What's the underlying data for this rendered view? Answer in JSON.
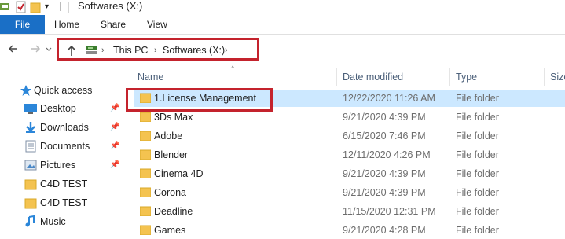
{
  "window": {
    "title": "Softwares (X:)"
  },
  "ribbon": {
    "tabs": [
      "File",
      "Home",
      "Share",
      "View"
    ]
  },
  "address": {
    "crumbs": [
      "This PC",
      "Softwares (X:)"
    ]
  },
  "sidebar": {
    "items": [
      {
        "label": "Quick access",
        "icon": "star-icon",
        "pinned": false
      },
      {
        "label": "Desktop",
        "icon": "desktop-icon",
        "pinned": true
      },
      {
        "label": "Downloads",
        "icon": "downloads-icon",
        "pinned": true
      },
      {
        "label": "Documents",
        "icon": "documents-icon",
        "pinned": true
      },
      {
        "label": "Pictures",
        "icon": "pictures-icon",
        "pinned": true
      },
      {
        "label": "C4D TEST",
        "icon": "folder-icon",
        "pinned": false
      },
      {
        "label": "C4D TEST",
        "icon": "folder-icon",
        "pinned": false
      },
      {
        "label": "Music",
        "icon": "music-icon",
        "pinned": false
      }
    ]
  },
  "columns": {
    "name": "Name",
    "date": "Date modified",
    "type": "Type",
    "size": "Size"
  },
  "files": [
    {
      "name": "1.License Management",
      "date": "12/22/2020 11:26 AM",
      "type": "File folder",
      "selected": true
    },
    {
      "name": "3Ds Max",
      "date": "9/21/2020 4:39 PM",
      "type": "File folder",
      "selected": false
    },
    {
      "name": "Adobe",
      "date": "6/15/2020 7:46 PM",
      "type": "File folder",
      "selected": false
    },
    {
      "name": "Blender",
      "date": "12/11/2020 4:26 PM",
      "type": "File folder",
      "selected": false
    },
    {
      "name": "Cinema 4D",
      "date": "9/21/2020 4:39 PM",
      "type": "File folder",
      "selected": false
    },
    {
      "name": "Corona",
      "date": "9/21/2020 4:39 PM",
      "type": "File folder",
      "selected": false
    },
    {
      "name": "Deadline",
      "date": "11/15/2020 12:31 PM",
      "type": "File folder",
      "selected": false
    },
    {
      "name": "Games",
      "date": "9/21/2020 4:28 PM",
      "type": "File folder",
      "selected": false
    }
  ],
  "colors": {
    "accent": "#1a6fc6",
    "highlight": "#c4232d",
    "selection": "#cce8ff",
    "folder": "#f4c350"
  }
}
